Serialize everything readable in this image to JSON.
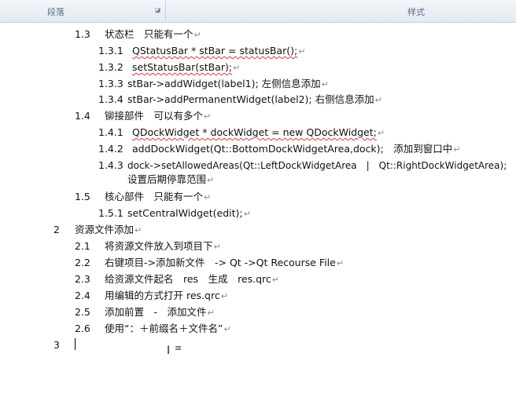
{
  "ribbon": {
    "paragraph_label": "段落",
    "styles_label": "样式"
  },
  "lines": [
    {
      "num": "1.3",
      "text": "状态栏　只能有一个"
    },
    {
      "num": "1.3.1",
      "text": "QStatusBar * stBar = statusBar();"
    },
    {
      "num": "1.3.2",
      "text": "setStatusBar(stBar);"
    },
    {
      "num": "1.3.3",
      "text": "stBar->addWidget(label1); 左侧信息添加"
    },
    {
      "num": "1.3.4",
      "text": "stBar->addPermanentWidget(label2); 右侧信息添加"
    },
    {
      "num": "1.4",
      "text": "铆接部件　可以有多个"
    },
    {
      "num": "1.4.1",
      "text": "QDockWidget * dockWidget = new QDockWidget;"
    },
    {
      "num": "1.4.2",
      "text": "addDockWidget(Qt::BottomDockWidgetArea,dock);　添加到窗口中"
    },
    {
      "num": "1.4.3",
      "text": "dock->setAllowedAreas(Qt::LeftDockWidgetArea　|　Qt::RightDockWidgetArea);"
    },
    {
      "num": "",
      "text": "设置后期停靠范围"
    },
    {
      "num": "1.5",
      "text": "核心部件　只能有一个"
    },
    {
      "num": "1.5.1",
      "text": "setCentralWidget(edit);"
    },
    {
      "num": "2",
      "text": "资源文件添加"
    },
    {
      "num": "2.1",
      "text": "将资源文件放入到项目下"
    },
    {
      "num": "2.2",
      "text": "右键项目->添加新文件　-> Qt ->Qt Recourse File"
    },
    {
      "num": "2.3",
      "text": "给资源文件起名　res　生成　res.qrc"
    },
    {
      "num": "2.4",
      "text": "用编辑的方式打开 res.qrc"
    },
    {
      "num": "2.5",
      "text": "添加前置　-　添加文件"
    },
    {
      "num": "2.6",
      "text": "使用“：＋前缀名＋文件名”"
    },
    {
      "num": "3",
      "text": ""
    }
  ],
  "paragraph_mark": "↵",
  "icons": {
    "launcher": "dialog-launcher-icon",
    "cursor": "ibeam-cursor-icon"
  }
}
